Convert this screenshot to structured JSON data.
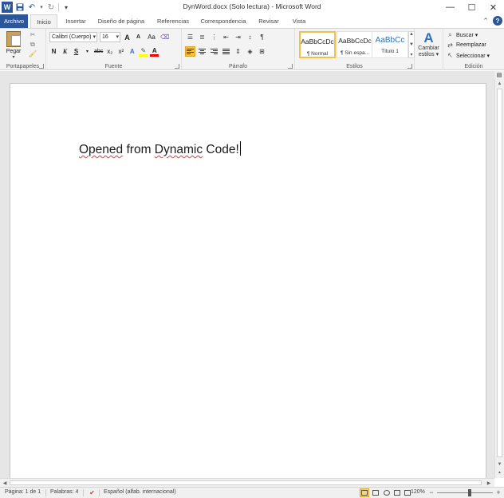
{
  "window": {
    "title": "DynWord.docx (Solo lectura)  -  Microsoft Word",
    "app_icon": "W",
    "controls": [
      "minimize",
      "maximize",
      "close"
    ]
  },
  "quick_access": {
    "items": [
      "save-icon",
      "undo-icon",
      "redo-icon",
      "customize-icon"
    ]
  },
  "tabs": [
    {
      "label": "Archivo"
    },
    {
      "label": "Inicio"
    },
    {
      "label": "Insertar"
    },
    {
      "label": "Diseño de página"
    },
    {
      "label": "Referencias"
    },
    {
      "label": "Correspondencia"
    },
    {
      "label": "Revisar"
    },
    {
      "label": "Vista"
    }
  ],
  "ribbon": {
    "clipboard": {
      "label": "Portapapeles",
      "paste_label": "Pegar"
    },
    "font": {
      "label": "Fuente",
      "font_name": "Calibri (Cuerpo)",
      "font_size": "16",
      "grow": "A",
      "shrink": "A",
      "change_case": "Aa",
      "bold": "N",
      "italic": "K",
      "underline": "S",
      "strike": "abc",
      "subscript": "x₂",
      "superscript": "x²",
      "text_effects": "A",
      "font_color": "A",
      "highlight_color": "#ffff00",
      "font_color_value": "#e00000"
    },
    "paragraph": {
      "label": "Párrafo",
      "pilcrow": "¶"
    },
    "styles": {
      "label": "Estilos",
      "items": [
        {
          "sample": "AaBbCcDc",
          "name": "¶ Normal",
          "selected": true
        },
        {
          "sample": "AaBbCcDc",
          "name": "¶ Sin espa...",
          "selected": false
        },
        {
          "sample": "AaBbCс",
          "name": "Título 1",
          "selected": false
        }
      ],
      "change_label_1": "Cambiar",
      "change_label_2": "estilos ▾"
    },
    "editing": {
      "label": "Edición",
      "find": "Buscar ▾",
      "replace": "Reemplazar",
      "select": "Seleccionar ▾"
    }
  },
  "document": {
    "text_a": "Opened",
    "text_b": " from ",
    "text_c": "Dynamic",
    "text_d": " Code!"
  },
  "statusbar": {
    "page": "Página: 1 de 1",
    "words": "Palabras: 4",
    "language": "Español (alfab. internacional)",
    "zoom": "120%",
    "zoom_minus": "−",
    "zoom_plus": "+"
  }
}
